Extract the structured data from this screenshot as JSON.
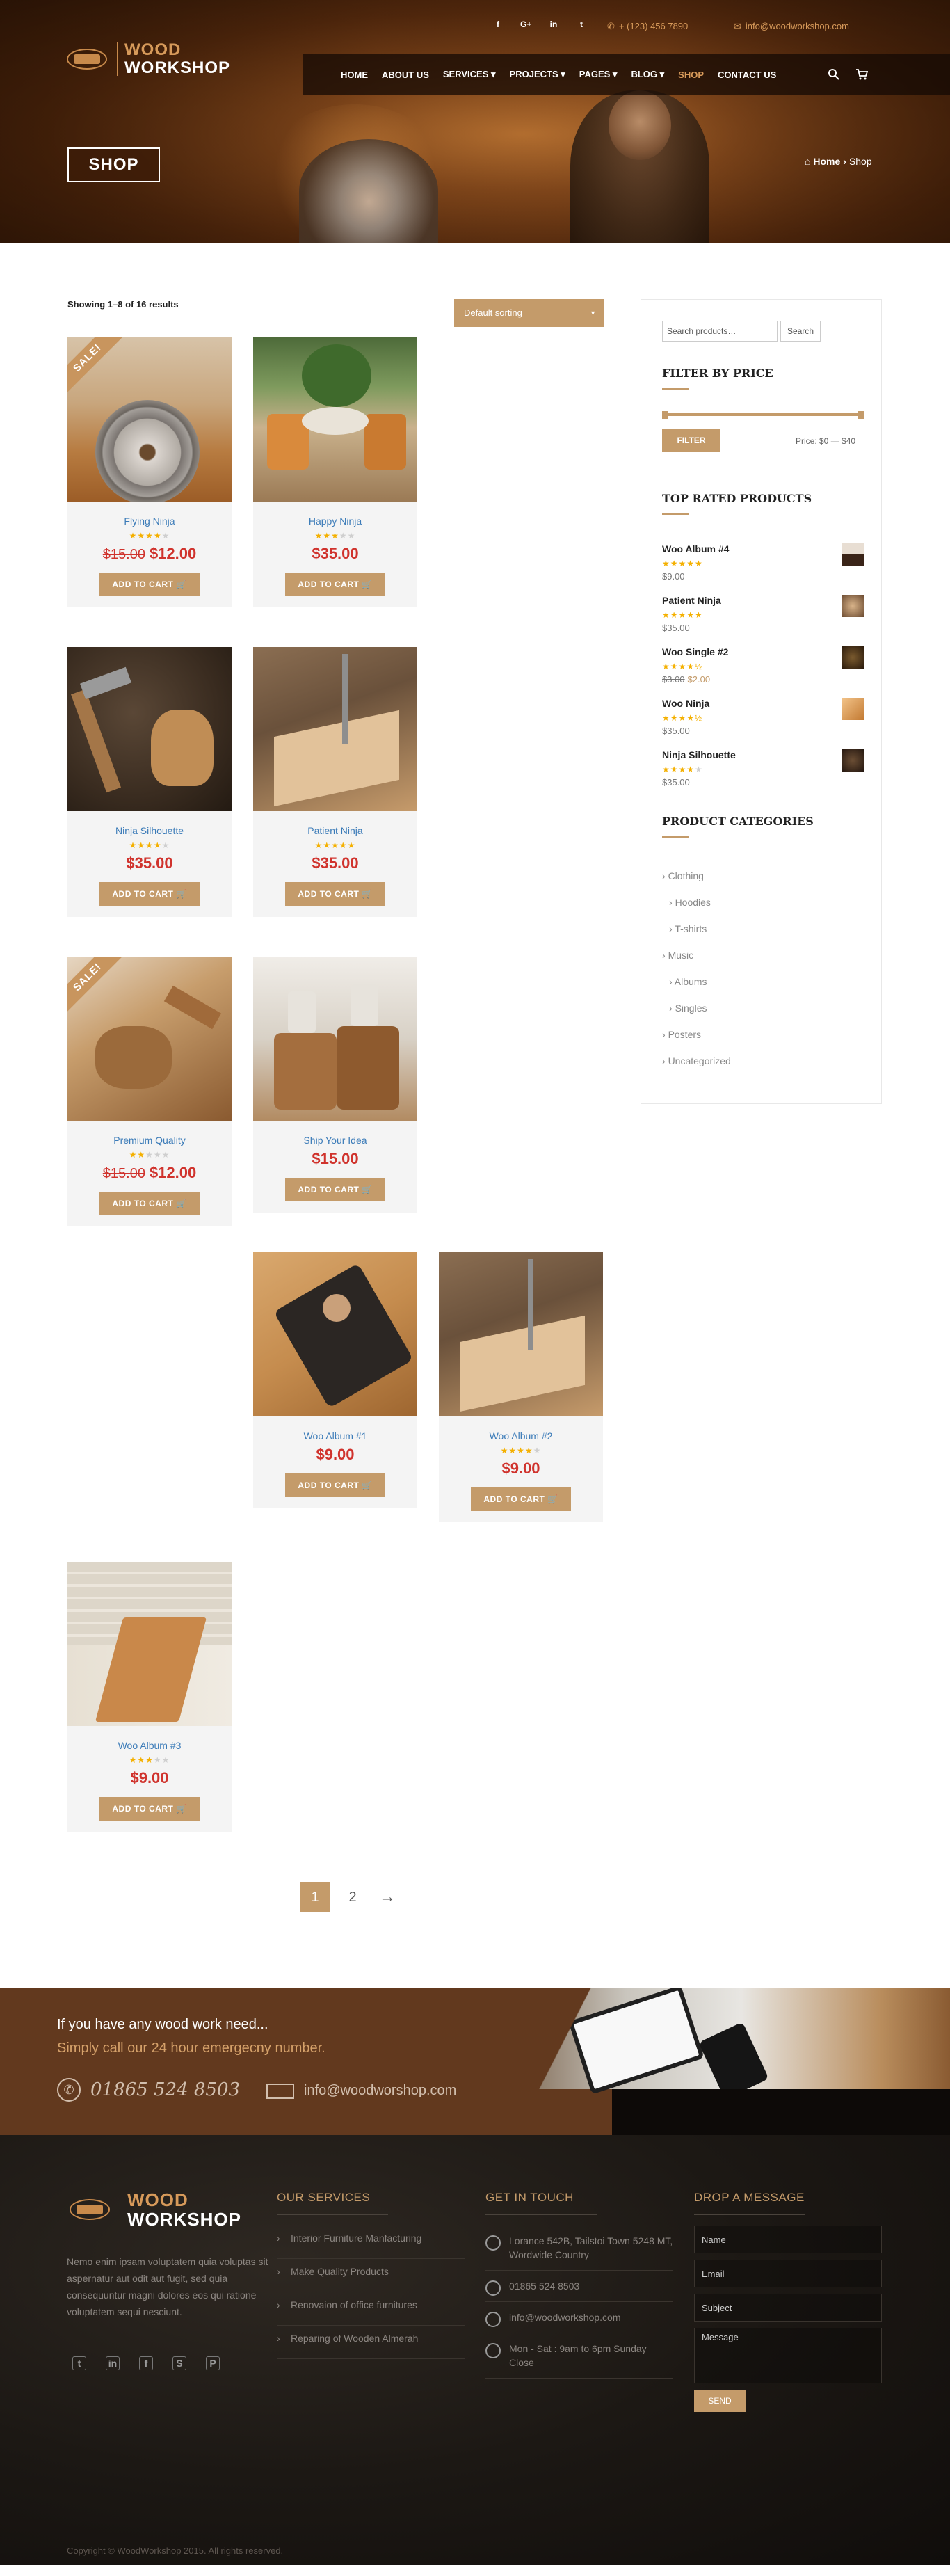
{
  "topbar": {
    "social": [
      "f",
      "G+",
      "in",
      "t"
    ],
    "phone": "+ (123) 456 7890",
    "email": "info@woodworkshop.com"
  },
  "logo": {
    "line1": "WOOD",
    "line2": "WORKSHOP"
  },
  "nav": {
    "items": [
      "HOME",
      "ABOUT US",
      "SERVICES ▾",
      "PROJECTS ▾",
      "PAGES ▾",
      "BLOG ▾",
      "SHOP",
      "CONTACT US"
    ],
    "active": "SHOP"
  },
  "hero": {
    "title": "SHOP",
    "breadcrumb_home": "Home",
    "breadcrumb_sep": "›",
    "breadcrumb_current": "Shop"
  },
  "shop": {
    "result_count": "Showing 1–8 of 16 results",
    "sorting": "Default sorting",
    "add_to_cart": "ADD TO CART",
    "sale_label": "SALE!",
    "products": [
      {
        "title": "Flying Ninja",
        "rating": 4,
        "old_price": "$15.00",
        "price": "$12.00",
        "sale": true
      },
      {
        "title": "Happy Ninja",
        "rating": 3,
        "old_price": "",
        "price": "$35.00",
        "sale": false
      },
      {
        "title": "Ninja Silhouette",
        "rating": 4,
        "old_price": "",
        "price": "$35.00",
        "sale": false
      },
      {
        "title": "Patient Ninja",
        "rating": 5,
        "old_price": "",
        "price": "$35.00",
        "sale": false
      },
      {
        "title": "Premium Quality",
        "rating": 2,
        "old_price": "$15.00",
        "price": "$12.00",
        "sale": true
      },
      {
        "title": "Ship Your Idea",
        "rating": 0,
        "old_price": "",
        "price": "$15.00",
        "sale": false
      },
      {
        "title": "Woo Album #1",
        "rating": 0,
        "old_price": "",
        "price": "$9.00",
        "sale": false
      },
      {
        "title": "Woo Album #2",
        "rating": 4,
        "old_price": "",
        "price": "$9.00",
        "sale": false
      },
      {
        "title": "Woo Album #3",
        "rating": 3,
        "old_price": "",
        "price": "$9.00",
        "sale": false
      }
    ]
  },
  "sidebar": {
    "search_placeholder": "Search products…",
    "search_button": "Search",
    "filter_title": "FILTER BY PRICE",
    "filter_button": "FILTER",
    "price_range": "Price: $0 — $40",
    "top_rated_title": "TOP RATED PRODUCTS",
    "top_rated": [
      {
        "name": "Woo Album #4",
        "rating": 5,
        "old_price": "",
        "price": "$9.00"
      },
      {
        "name": "Patient Ninja",
        "rating": 5,
        "old_price": "",
        "price": "$35.00"
      },
      {
        "name": "Woo Single #2",
        "rating": 4.5,
        "old_price": "$3.00",
        "price": "$2.00"
      },
      {
        "name": "Woo Ninja",
        "rating": 4.5,
        "old_price": "",
        "price": "$35.00"
      },
      {
        "name": "Ninja Silhouette",
        "rating": 4,
        "old_price": "",
        "price": "$35.00"
      }
    ],
    "categories_title": "PRODUCT CATEGORIES",
    "categories": [
      {
        "label": "Clothing",
        "sub": false
      },
      {
        "label": "Hoodies",
        "sub": true
      },
      {
        "label": "T-shirts",
        "sub": true
      },
      {
        "label": "Music",
        "sub": false
      },
      {
        "label": "Albums",
        "sub": true
      },
      {
        "label": "Singles",
        "sub": true
      },
      {
        "label": "Posters",
        "sub": false
      },
      {
        "label": "Uncategorized",
        "sub": false
      }
    ]
  },
  "pagination": {
    "pages": [
      "1",
      "2"
    ],
    "current": "1",
    "next": "→"
  },
  "cta": {
    "line1": "If you have any wood work need...",
    "line2": "Simply call our 24 hour emergecny number.",
    "phone": "01865 524 8503",
    "email": "info@woodworshop.com"
  },
  "footer": {
    "about": "Nemo enim ipsam voluptatem quia voluptas sit aspernatur aut odit aut fugit, sed quia consequuntur magni dolores eos qui ratione voluptatem sequi nesciunt.",
    "social": [
      "t",
      "in",
      "f",
      "S",
      "P"
    ],
    "services_title": "OUR SERVICES",
    "services": [
      "Interior Furniture Manfacturing",
      "Make Quality Products",
      "Renovaion of office furnitures",
      "Reparing of Wooden Almerah"
    ],
    "touch_title": "GET IN TOUCH",
    "address": "Lorance 542B, Tailstoi Town 5248 MT, Wordwide Country",
    "phone": "01865 524 8503",
    "email": "info@woodworkshop.com",
    "hours": "Mon - Sat : 9am to 6pm Sunday Close",
    "message_title": "DROP A MESSAGE",
    "form": {
      "name": "Name",
      "email": "Email",
      "subject": "Subject",
      "message": "Message",
      "send": "SEND"
    },
    "copyright": "Copyright © WoodWorkshop 2015. All rights reserved."
  },
  "colors": {
    "accent": "#c49b6a",
    "price_red": "#d0332d",
    "link_blue": "#3b7bb8",
    "cta_brown": "#62391e",
    "footer_dark": "#1c1814"
  }
}
